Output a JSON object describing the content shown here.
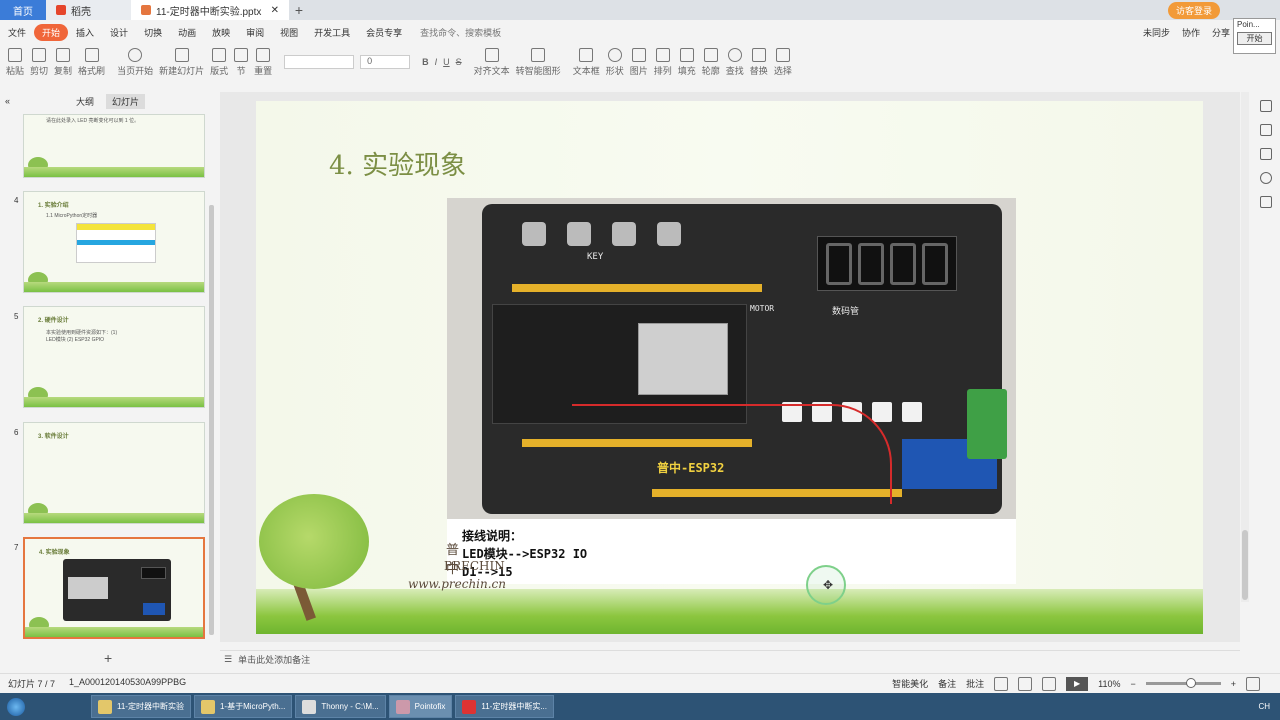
{
  "tabs": {
    "home": "首页",
    "doc": "稻壳",
    "ppt": "11-定时器中断实验.pptx",
    "login": "访客登录"
  },
  "menu": {
    "file": "文件",
    "start": "开始",
    "items": [
      "插入",
      "设计",
      "切换",
      "动画",
      "放映",
      "审阅",
      "视图",
      "开发工具",
      "会员专享"
    ],
    "search": "查找命令、搜索模板",
    "sync": "未同步",
    "collab": "协作",
    "share": "分享"
  },
  "toolbar": {
    "paste": "粘贴",
    "cut": "剪切",
    "copy": "复制",
    "format_painter": "格式刷",
    "from_start": "当页开始",
    "new_slide": "新建幻灯片",
    "layout": "版式",
    "section": "节",
    "reset": "重置",
    "font_size": "0",
    "align_text": "对齐文本",
    "smart_art": "转智能图形",
    "textbox": "文本框",
    "shape": "形状",
    "arrange": "排列",
    "picture": "图片",
    "fill": "填充",
    "outline": "轮廓",
    "find": "查找",
    "replace": "替换",
    "select": "选择"
  },
  "mini_panel": {
    "title": "Poin...",
    "button": "开始"
  },
  "left_panel": {
    "tab_outline": "大纲",
    "tab_slides": "幻灯片",
    "thumbs": [
      {
        "num": "",
        "title": "",
        "line": "请在此处录入 LED 亮断变化可以到 1 位。"
      },
      {
        "num": "4",
        "title": "1. 实验介绍",
        "line": "1.1 MicroPython定时器"
      },
      {
        "num": "5",
        "title": "2. 硬件设计",
        "line": "本实验使用到硬件资源如下：(1) LED模块 (2) ESP32 GPIO"
      },
      {
        "num": "6",
        "title": "3. 软件设计",
        "line": ""
      },
      {
        "num": "7",
        "title": "4. 实验现象",
        "line": ""
      }
    ]
  },
  "slide": {
    "title": "4. 实验现象",
    "brand_cn": "普中",
    "brand_en": "PRECHIN",
    "brand_url": "www.prechin.cn",
    "notes_lines": [
      "接线说明：",
      "LED模块-->ESP32 IO",
      "D1-->15"
    ],
    "board_label": "普中-ESP32",
    "board_key": "KEY",
    "board_motor": "MOTOR",
    "board_seg": "数码管"
  },
  "notes_placeholder": "单击此处添加备注",
  "status": {
    "slide_count": "幻灯片 7 / 7",
    "file_id": "1_A000120140530A99PPBG",
    "beautify": "智能美化",
    "notes": "备注",
    "comments": "批注",
    "zoom": "110%"
  },
  "taskbar": {
    "items": [
      "11-定时器中断实验",
      "1-基于MicroPyth...",
      "Thonny - C:\\M...",
      "Pointofix",
      "11-定时器中断实..."
    ],
    "tray_text": "CH"
  }
}
